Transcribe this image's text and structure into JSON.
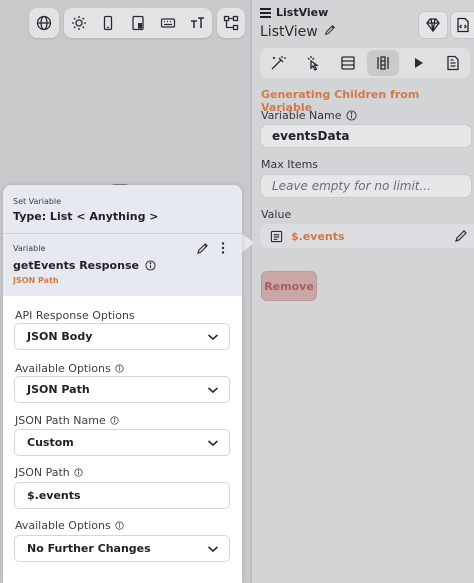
{
  "canvas_toolbar": {
    "icons": [
      "globe-icon",
      "sun-icon",
      "phone-icon",
      "tablet-icon",
      "keyboard-icon",
      "text-size-icon",
      "node-tree-icon"
    ]
  },
  "right_panel": {
    "widget_type": "ListView",
    "widget_name": "ListView",
    "tabs": [
      "properties-tab",
      "actions-tab",
      "backend-query-tab",
      "generate-children-tab",
      "preview-tab",
      "docs-tab"
    ],
    "section_title": "Generating Children from Variable",
    "variable_name_label": "Variable Name",
    "variable_name_value": "eventsData",
    "max_items_label": "Max Items",
    "max_items_placeholder": "Leave empty for no limit...",
    "value_label": "Value",
    "value_text": "$.events",
    "remove_label": "Remove"
  },
  "popup": {
    "header_label": "Set Variable",
    "header_type": "Type: List < Anything >",
    "variable_label": "Variable",
    "variable_name": "getEvents Response",
    "variable_sub": "JSON Path",
    "fields": [
      {
        "label": "API Response Options",
        "value": "JSON Body",
        "info": false
      },
      {
        "label": "Available Options",
        "value": "JSON Path",
        "info": true
      },
      {
        "label": "JSON Path Name",
        "value": "Custom",
        "info": true
      },
      {
        "label": "JSON Path",
        "value": "$.events",
        "info": true
      },
      {
        "label": "Available Options",
        "value": "No Further Changes",
        "info": true
      }
    ]
  },
  "colors": {
    "accent_orange": "#cf7a4a",
    "remove_red": "#a85f5f"
  }
}
